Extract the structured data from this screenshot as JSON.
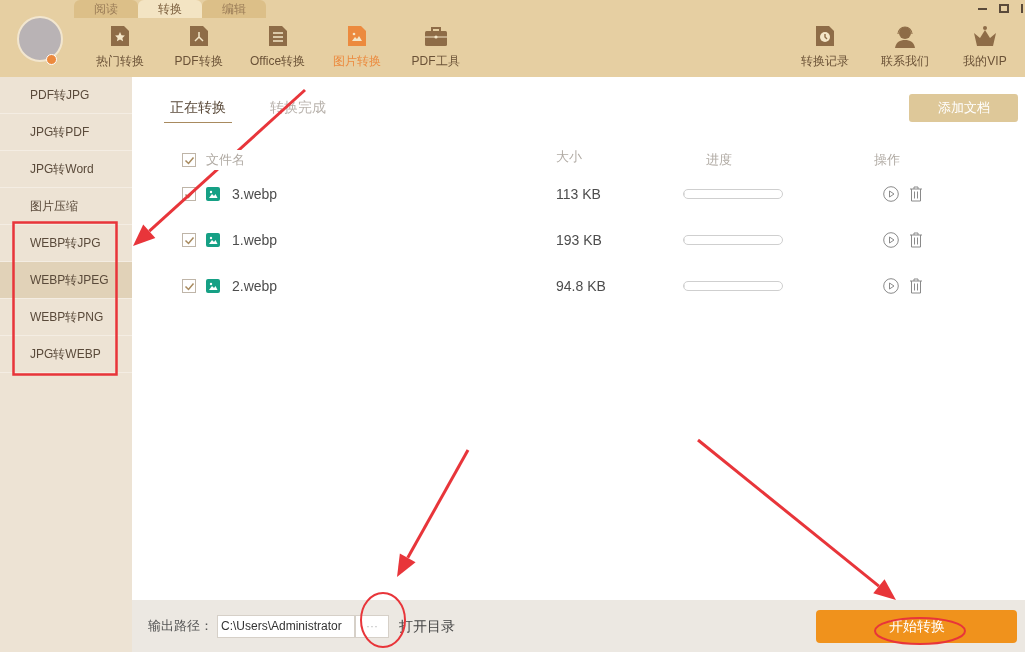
{
  "mode_tabs": [
    {
      "label": "阅读",
      "selected": false
    },
    {
      "label": "转换",
      "selected": true
    },
    {
      "label": "编辑",
      "selected": false
    }
  ],
  "nav_items": [
    {
      "label": "热门转换",
      "kind": "star",
      "selected": false
    },
    {
      "label": "PDF转换",
      "kind": "pdf",
      "selected": false
    },
    {
      "label": "Office转换",
      "kind": "doc",
      "selected": false
    },
    {
      "label": "图片转换",
      "kind": "image",
      "selected": true
    },
    {
      "label": "PDF工具",
      "kind": "toolbox",
      "selected": false
    }
  ],
  "right_items": [
    {
      "label": "转换记录",
      "kind": "clock"
    },
    {
      "label": "联系我们",
      "kind": "support"
    },
    {
      "label": "我的VIP",
      "kind": "crown"
    }
  ],
  "sidebar": {
    "items": [
      {
        "label": "PDF转JPG",
        "selected": false
      },
      {
        "label": "JPG转PDF",
        "selected": false
      },
      {
        "label": "JPG转Word",
        "selected": false
      },
      {
        "label": "图片压缩",
        "selected": false
      },
      {
        "label": "WEBP转JPG",
        "selected": false
      },
      {
        "label": "WEBP转JPEG",
        "selected": true
      },
      {
        "label": "WEBP转PNG",
        "selected": false
      },
      {
        "label": "JPG转WEBP",
        "selected": false
      }
    ]
  },
  "tabs": [
    {
      "label": "正在转换",
      "selected": true
    },
    {
      "label": "转换完成",
      "selected": false
    }
  ],
  "add_button": "添加文档",
  "table": {
    "select_all_checked": true,
    "columns": [
      "文件名",
      "大小",
      "进度",
      "操作"
    ],
    "rows": [
      {
        "name": "3.webp",
        "size": "113 KB",
        "checked": true,
        "level": 0
      },
      {
        "name": "1.webp",
        "size": "193 KB",
        "checked": true,
        "level": 0
      },
      {
        "name": "2.webp",
        "size": "94.8 KB",
        "checked": true,
        "level": 0
      }
    ]
  },
  "footer": {
    "label": "输出路径：",
    "path": "C:\\Users\\Administrator",
    "browse": "···",
    "open_dir": "打开目录",
    "start": "开始转换"
  }
}
